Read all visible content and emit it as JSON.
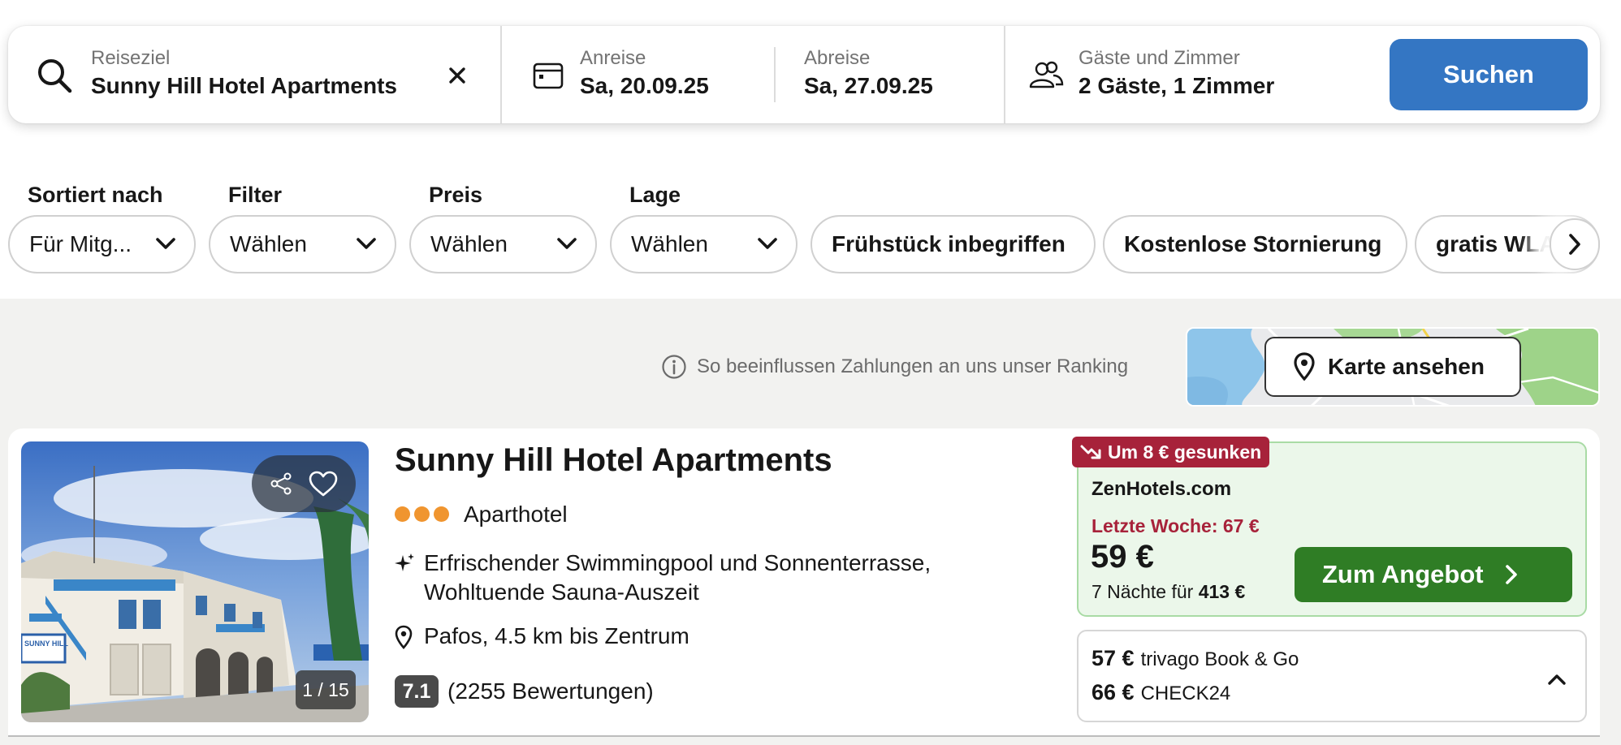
{
  "search": {
    "destination_label": "Reiseziel",
    "destination_value": "Sunny Hill Hotel Apartments",
    "checkin_label": "Anreise",
    "checkin_value": "Sa, 20.09.25",
    "checkout_label": "Abreise",
    "checkout_value": "Sa, 27.09.25",
    "guests_label": "Gäste und Zimmer",
    "guests_value": "2 Gäste, 1 Zimmer",
    "search_button": "Suchen",
    "icons": [
      "search-icon",
      "clear-icon",
      "calendar-icon",
      "guests-icon"
    ]
  },
  "filters": {
    "sort_label": "Sortiert nach",
    "sort_value": "Für Mitg...",
    "filter_label": "Filter",
    "filter_value": "Wählen",
    "price_label": "Preis",
    "price_value": "Wählen",
    "location_label": "Lage",
    "location_value": "Wählen",
    "chips": [
      "Frühstück inbegriffen",
      "Kostenlose Stornierung",
      "gratis WLAN"
    ]
  },
  "ranking_notice": "So beeinflussen Zahlungen an uns unser Ranking",
  "map_button": "Karte ansehen",
  "result": {
    "photo_counter": "1 / 15",
    "photo_sign": "SUNNY HILL",
    "name": "Sunny Hill Hotel Apartments",
    "stars": 3,
    "type": "Aparthotel",
    "feature_line1": "Erfrischender Swimmingpool und Sonnenterrasse,",
    "feature_line2": "Wohltuende Sauna-Auszeit",
    "location": "Pafos, 4.5 km bis Zentrum",
    "rating": "7.1",
    "reviews": "(2255 Bewertungen)",
    "price_drop_badge": "Um 8 € gesunken",
    "provider": "ZenHotels.com",
    "last_week": "Letzte Woche: 67 €",
    "price": "59 €",
    "nights_prefix": "7 Nächte für",
    "nights_total": "413 €",
    "offer_button": "Zum Angebot",
    "alternatives": [
      {
        "price": "57 €",
        "provider": "trivago Book & Go"
      },
      {
        "price": "66 €",
        "provider": "CHECK24"
      }
    ],
    "colors": {
      "deal_green": "#2f7d25",
      "drop_red": "#a7223a",
      "star_orange": "#f0952f",
      "brand_blue": "#3476c3"
    }
  }
}
